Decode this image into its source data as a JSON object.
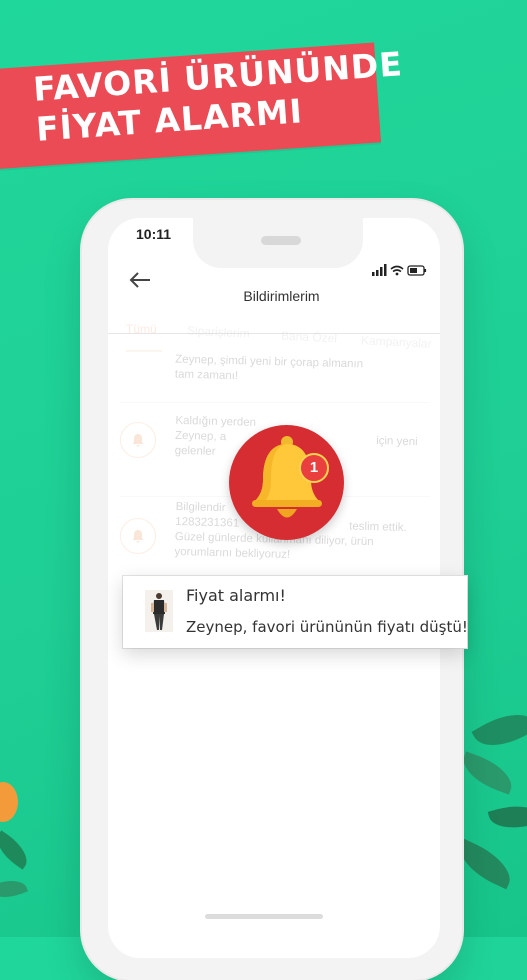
{
  "banner": {
    "line1": "FAVORİ ÜRÜNÜNDE",
    "line2": "FİYAT ALARMI"
  },
  "status_bar": {
    "time": "10:11",
    "icons": "signal wifi battery"
  },
  "header": {
    "title": "Bildirimlerim",
    "back_icon": "arrow-left-icon"
  },
  "tabs": [
    {
      "label": "Tümü",
      "active": true
    },
    {
      "label": "Siparişlerim",
      "active": false
    },
    {
      "label": "Bana Özel",
      "active": false
    },
    {
      "label": "Kampanyalar",
      "active": false
    }
  ],
  "notifications": [
    {
      "title": "",
      "text_line1": "Zeynep, şimdi yeni bir çorap almanın",
      "text_line2": "tam zamanı!"
    },
    {
      "title": "Kaldığın yerden",
      "text_line1": "Zeynep, a",
      "text_line1_end": "için yeni",
      "text_line2": "gelenler"
    },
    {
      "title": "Bilgilendir",
      "text_line1": "1283231361",
      "text_line1_end": "teslim ettik.",
      "text_line2": "Güzel günlerde kullanmanı diliyor, ürün",
      "text_line3": "yorumlarını bekliyoruz!"
    }
  ],
  "bell": {
    "icon": "bell-icon",
    "badge_count": "1"
  },
  "toast": {
    "title": "Fiyat alarmı!",
    "body": "Zeynep, favori ürününün fiyatı düştü!"
  },
  "colors": {
    "background": "#20d79b",
    "banner": "#ea4b55",
    "bell_circle": "#d62d33",
    "bell": "#ffc83a"
  }
}
